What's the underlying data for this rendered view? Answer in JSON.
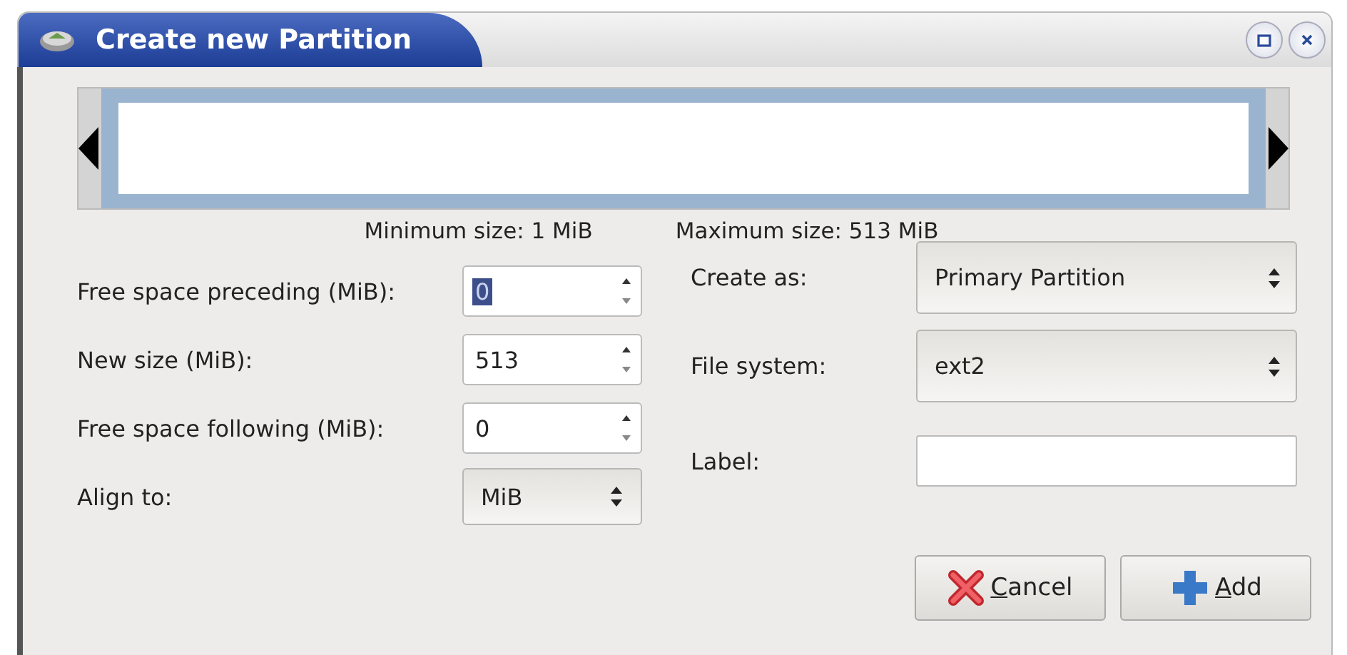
{
  "window": {
    "title": "Create new Partition"
  },
  "size_limits": {
    "minimum": "Minimum size: 1 MiB",
    "maximum": "Maximum size: 513 MiB"
  },
  "left_fields": [
    {
      "label": "Free space preceding (MiB):",
      "kind": "spin",
      "value": "0",
      "text_selected": true
    },
    {
      "label": "New size (MiB):",
      "kind": "spin",
      "value": "513",
      "text_selected": false
    },
    {
      "label": "Free space following (MiB):",
      "kind": "spin",
      "value": "0",
      "text_selected": false
    },
    {
      "label": "Align to:",
      "kind": "combo",
      "value": "MiB"
    }
  ],
  "right_fields": [
    {
      "label": "Create as:",
      "kind": "combo",
      "value": "Primary Partition"
    },
    {
      "label": "File system:",
      "kind": "combo",
      "value": "ext2"
    },
    {
      "label": "Label:",
      "kind": "text"
    }
  ],
  "buttons": [
    {
      "label": "Cancel",
      "kind": "cancel"
    },
    {
      "label": "Add",
      "kind": "add"
    }
  ]
}
